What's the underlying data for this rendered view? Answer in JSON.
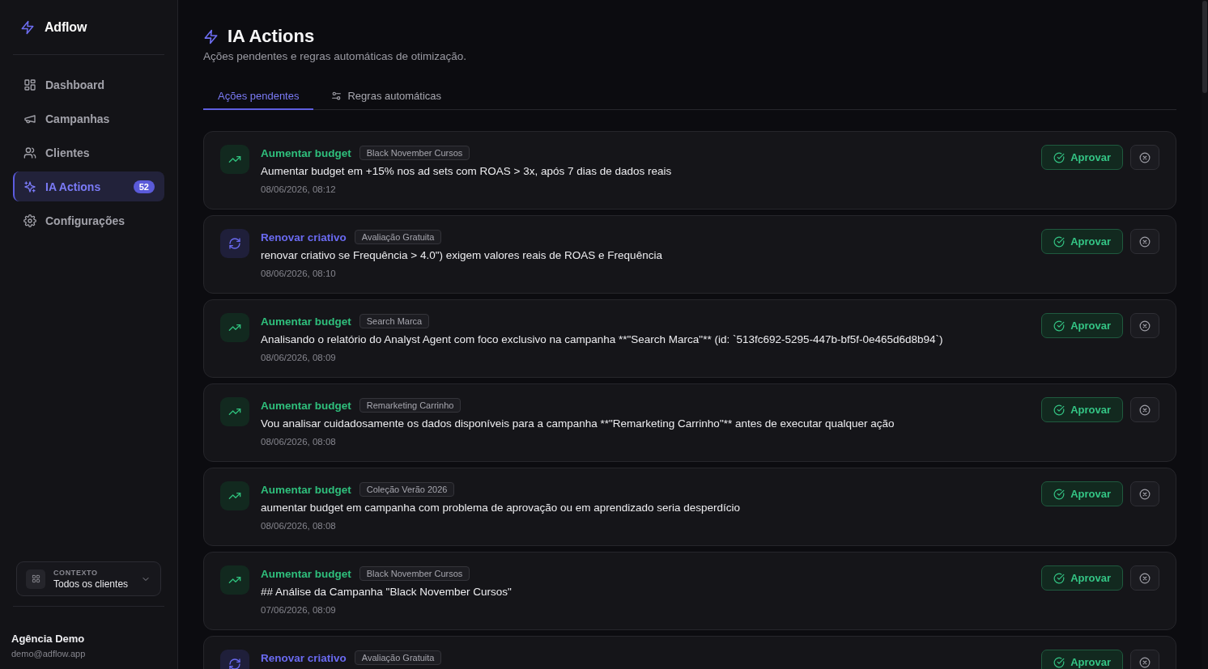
{
  "sidebar": {
    "brand": "Adflow",
    "nav": [
      {
        "label": "Dashboard",
        "selected": false
      },
      {
        "label": "Campanhas",
        "selected": false
      },
      {
        "label": "Clientes",
        "selected": false
      },
      {
        "label": "IA Actions",
        "selected": true,
        "badge": "52"
      },
      {
        "label": "Configurações",
        "selected": false
      }
    ],
    "context": {
      "label": "CONTEXTO",
      "value": "Todos os clientes"
    },
    "user": {
      "name": "Agência Demo",
      "email": "demo@adflow.app"
    }
  },
  "header": {
    "title": "IA Actions",
    "subtitle": "Ações pendentes e regras automáticas de otimização."
  },
  "tabs": [
    {
      "label": "Ações pendentes",
      "selected": true
    },
    {
      "label": "Regras automáticas",
      "selected": false
    }
  ],
  "actions": [
    {
      "kind": "budget",
      "title": "Aumentar budget",
      "tag": "Black November Cursos",
      "description": "Aumentar budget em +15% nos ad sets com ROAS > 3x, após 7 dias de dados reais",
      "date": "08/06/2026, 08:12",
      "approve": "Aprovar"
    },
    {
      "kind": "creative",
      "title": "Renovar criativo",
      "tag": "Avaliação Gratuita",
      "description": "renovar criativo se Frequência > 4.0\") exigem valores reais de ROAS e Frequência",
      "date": "08/06/2026, 08:10",
      "approve": "Aprovar"
    },
    {
      "kind": "budget",
      "title": "Aumentar budget",
      "tag": "Search Marca",
      "description": "Analisando o relatório do Analyst Agent com foco exclusivo na campanha **\"Search Marca\"** (id: `513fc692-5295-447b-bf5f-0e465d6d8b94`)",
      "date": "08/06/2026, 08:09",
      "approve": "Aprovar"
    },
    {
      "kind": "budget",
      "title": "Aumentar budget",
      "tag": "Remarketing Carrinho",
      "description": "Vou analisar cuidadosamente os dados disponíveis para a campanha **\"Remarketing Carrinho\"** antes de executar qualquer ação",
      "date": "08/06/2026, 08:08",
      "approve": "Aprovar"
    },
    {
      "kind": "budget",
      "title": "Aumentar budget",
      "tag": "Coleção Verão 2026",
      "description": "aumentar budget em campanha com problema de aprovação ou em aprendizado seria desperdício",
      "date": "08/06/2026, 08:08",
      "approve": "Aprovar"
    },
    {
      "kind": "budget",
      "title": "Aumentar budget",
      "tag": "Black November Cursos",
      "description": "## Análise da Campanha \"Black November Cursos\"",
      "date": "07/06/2026, 08:09",
      "approve": "Aprovar"
    },
    {
      "kind": "creative",
      "title": "Renovar criativo",
      "tag": "Avaliação Gratuita",
      "approve": "Aprovar"
    }
  ]
}
